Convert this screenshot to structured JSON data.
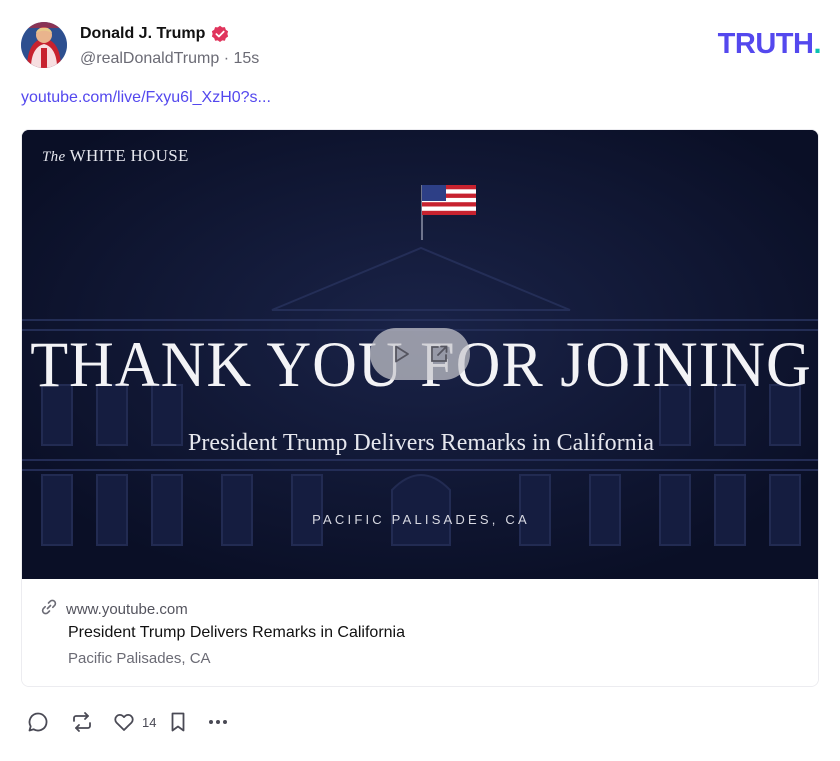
{
  "post": {
    "author_name": "Donald J. Trump",
    "handle": "@realDonaldTrump",
    "time": "15s",
    "meta_separator": " · ",
    "link_text": "youtube.com/live/Fxyu6l_XzH0?s..."
  },
  "brand": {
    "logo_main": "TRUTH",
    "logo_dot": ".",
    "logo_color": "#5448ee",
    "dot_color": "#0bc2b1"
  },
  "card": {
    "thumbnail": {
      "org_article": "The",
      "org_name": "WHITE HOUSE",
      "headline": "THANK YOU FOR JOINING",
      "subhead": "President Trump Delivers Remarks in California",
      "location": "PACIFIC PALISADES, CA"
    },
    "domain": "www.youtube.com",
    "title": "President Trump Delivers Remarks in California",
    "description": "Pacific Palisades, CA"
  },
  "actions": {
    "reply_icon": "comment-icon",
    "retruth_icon": "repost-icon",
    "like_icon": "heart-icon",
    "like_count": "14",
    "bookmark_icon": "bookmark-icon",
    "more_icon": "more-icon"
  }
}
